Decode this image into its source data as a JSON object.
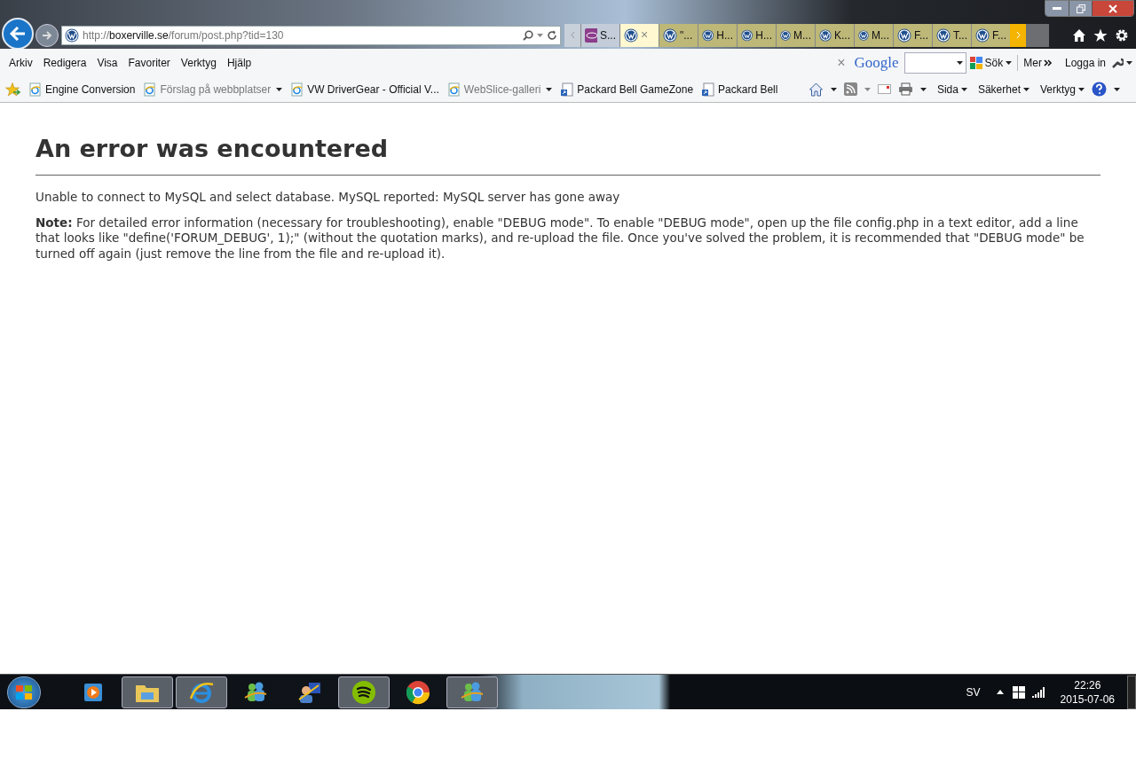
{
  "address": {
    "scheme": "http://",
    "host": "boxerville.se",
    "path": "/forum/post.php?tid=130"
  },
  "tabs": [
    {
      "kind": "site",
      "label": "S...",
      "selected": false
    },
    {
      "kind": "vw",
      "selected": true,
      "close": "×"
    },
    {
      "kind": "vw",
      "label": "\"...",
      "selected": false
    },
    {
      "kind": "vw",
      "label": "H...",
      "selected": false
    },
    {
      "kind": "vw",
      "label": "H...",
      "selected": false
    },
    {
      "kind": "vw",
      "label": "M...",
      "selected": false
    },
    {
      "kind": "vw",
      "label": "K...",
      "selected": false
    },
    {
      "kind": "vw",
      "label": "M...",
      "selected": false
    },
    {
      "kind": "vw",
      "label": "F...",
      "selected": false
    },
    {
      "kind": "vw",
      "label": "T...",
      "selected": false
    },
    {
      "kind": "vw",
      "label": "F...",
      "selected": false
    }
  ],
  "menu": [
    "Arkiv",
    "Redigera",
    "Visa",
    "Favoriter",
    "Verktyg",
    "Hjälp"
  ],
  "google_bar": {
    "close": "×",
    "logo": "Google",
    "search_button": "Sök",
    "more": "Mer",
    "login": "Logga in"
  },
  "favorites": [
    {
      "kind": "page",
      "label": "Engine Conversion",
      "dropdown": false,
      "dimmed": false
    },
    {
      "kind": "page",
      "label": "Förslag på webbplatser",
      "dropdown": true,
      "dimmed": true
    },
    {
      "kind": "page",
      "label": "VW DriverGear - Official V...",
      "dropdown": false,
      "dimmed": false
    },
    {
      "kind": "page",
      "label": "WebSlice-galleri",
      "dropdown": true,
      "dimmed": true
    },
    {
      "kind": "shortcut",
      "label": "Packard Bell GameZone",
      "dropdown": false,
      "dimmed": false
    },
    {
      "kind": "shortcut",
      "label": "Packard Bell",
      "dropdown": false,
      "dimmed": false
    }
  ],
  "command_bar": [
    "Sida",
    "Säkerhet",
    "Verktyg"
  ],
  "page": {
    "heading": "An error was encountered",
    "message": "Unable to connect to MySQL and select database. MySQL reported: MySQL server has gone away",
    "note": "**Note:** For detailed error information (necessary for troubleshooting), enable \"DEBUG mode\". To enable \"DEBUG mode\", open up the file config.php in a text editor, add a line that looks like \"define('FORUM_DEBUG', 1);\" (without the quotation marks), and re-upload the file. Once you've solved the problem, it is recommended that \"DEBUG mode\" be turned off again (just remove the line from the file and re-upload it)."
  },
  "taskbar": {
    "apps": [
      {
        "kind": "media",
        "selected": false
      },
      {
        "kind": "folder",
        "selected": true
      },
      {
        "kind": "ie",
        "selected": true
      },
      {
        "kind": "people",
        "selected": false
      },
      {
        "kind": "support",
        "selected": false
      },
      {
        "kind": "music",
        "selected": true
      },
      {
        "kind": "chrome",
        "selected": false
      },
      {
        "kind": "people",
        "selected": true
      }
    ],
    "language": "SV",
    "time": "22:26",
    "date": "2015-07-06"
  }
}
